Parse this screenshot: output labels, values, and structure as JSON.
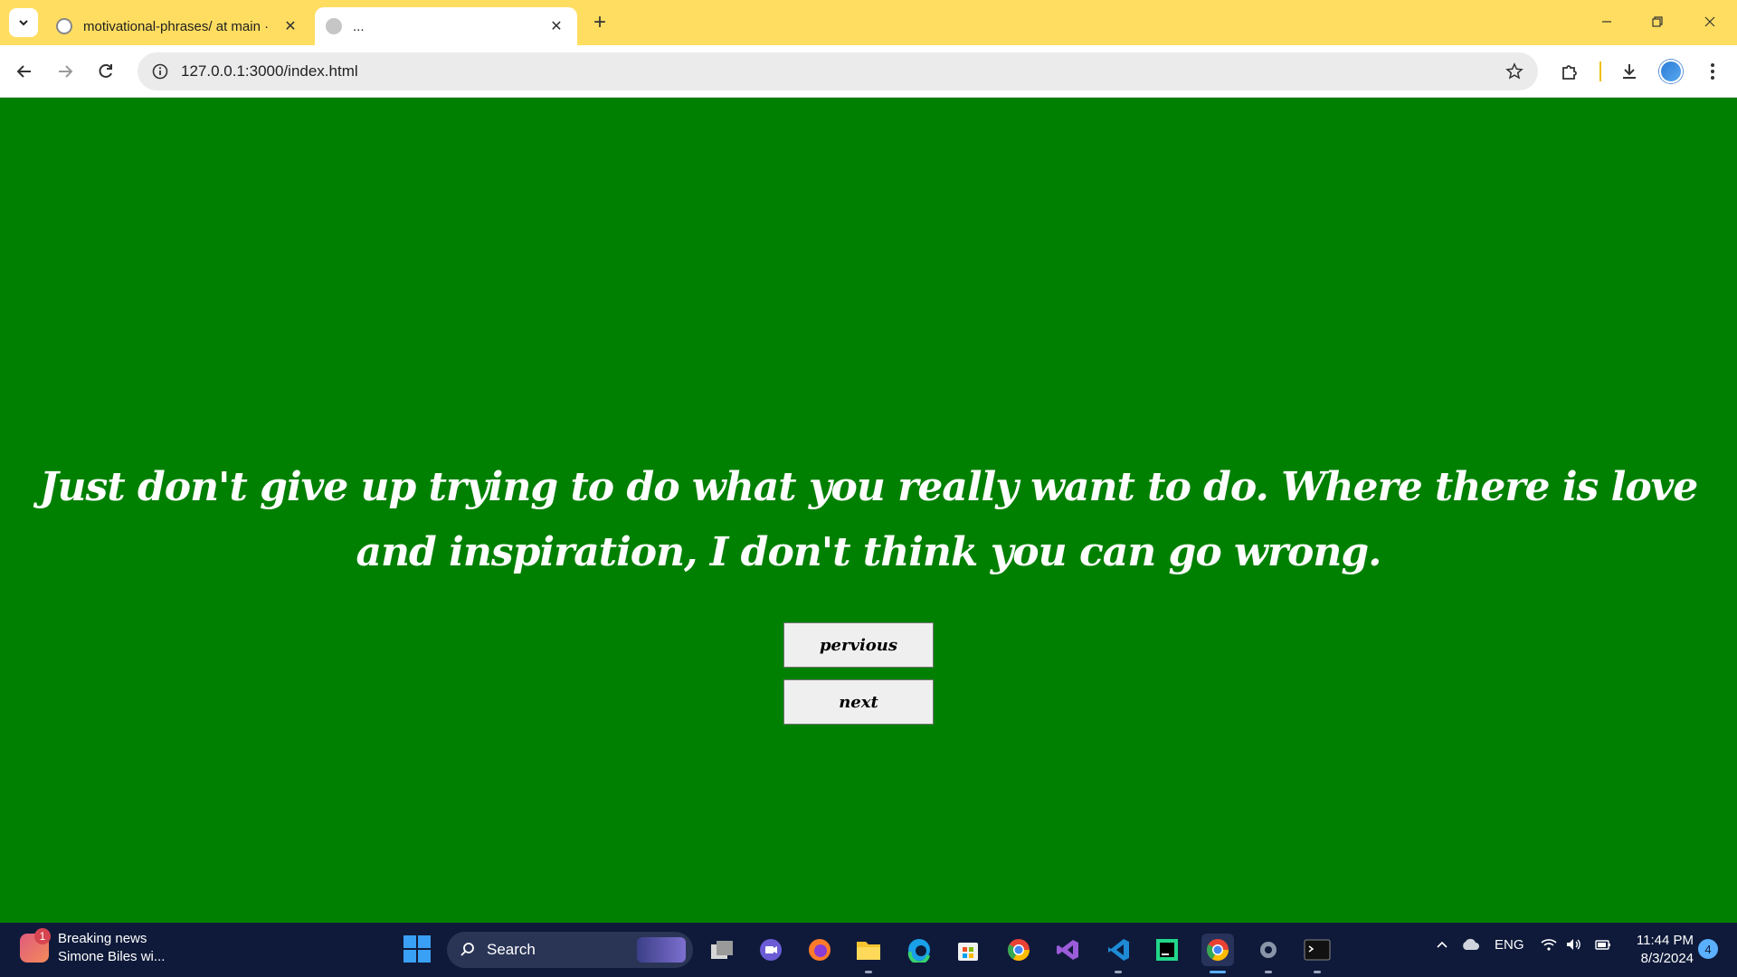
{
  "browser": {
    "tabs": [
      {
        "title": "motivational-phrases/ at main ·"
      },
      {
        "title": "..."
      }
    ],
    "url": "127.0.0.1:3000/index.html"
  },
  "page": {
    "background_color": "#008000",
    "quote": "Just don't give up trying to do what you really want to do. Where there is love and inspiration, I don't think you can go wrong.",
    "buttons": {
      "previous_label": "pervious",
      "next_label": "next"
    }
  },
  "taskbar": {
    "news": {
      "badge": "1",
      "headline": "Breaking news",
      "subtext": "Simone Biles wi..."
    },
    "search_placeholder": "Search",
    "tray": {
      "language": "ENG",
      "time": "11:44 PM",
      "date": "8/3/2024",
      "notification_count": "4"
    }
  }
}
